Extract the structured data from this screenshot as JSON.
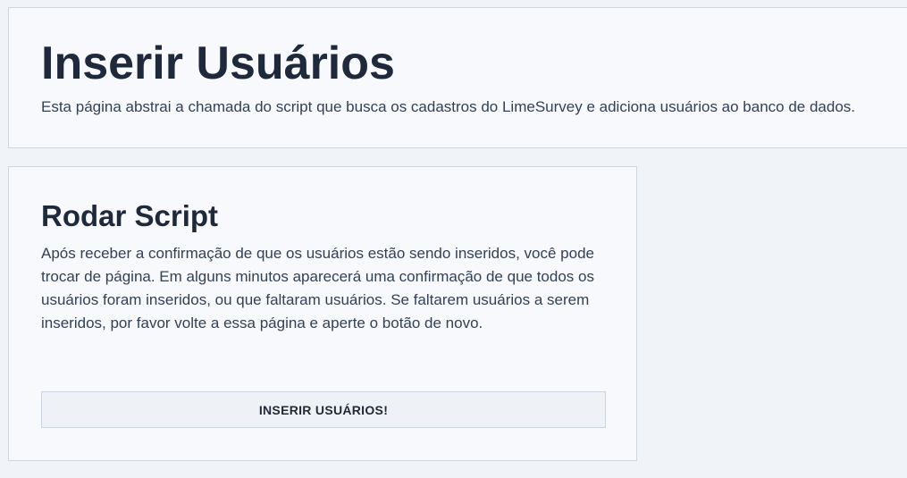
{
  "header": {
    "title": "Inserir Usuários",
    "description": "Esta página abstrai a chamada do script que busca os cadastros do LimeSurvey e adiciona usuários ao banco de dados."
  },
  "script_panel": {
    "title": "Rodar Script",
    "body": "Após receber a confirmação de que os usuários estão sendo inseridos, você pode trocar de página. Em alguns minutos aparecerá uma confirmação de que todos os usuários foram inseridos, ou que faltaram usuários. Se faltarem usuários a serem inseridos, por favor volte a essa página e aperte o botão de novo.",
    "button_label": "INSERIR USUÁRIOS!"
  }
}
